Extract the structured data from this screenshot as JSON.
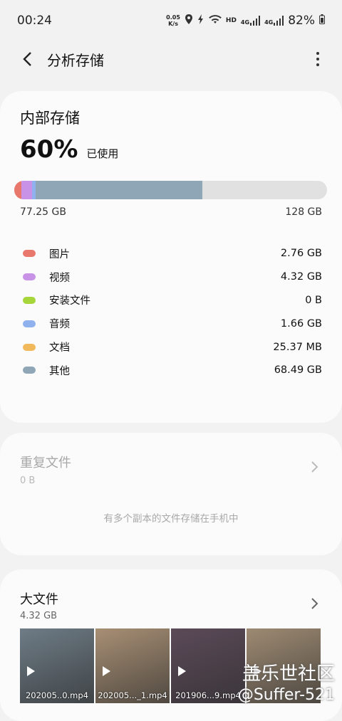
{
  "status_bar": {
    "time": "00:24",
    "net_speed_top": "0.05",
    "net_speed_bottom": "K/s",
    "hd": "HD",
    "lte1": "4G",
    "lte2": "4G",
    "battery": "82%"
  },
  "app_bar": {
    "title": "分析存储",
    "back_icon": "arrow-back-icon",
    "more_icon": "more-vert-icon"
  },
  "internal": {
    "title": "内部存储",
    "percent": "60%",
    "used_label": "已使用",
    "used": "77.25 GB",
    "total": "128 GB",
    "used_fraction": 0.6,
    "categories": [
      {
        "name": "图片",
        "value": "2.76 GB",
        "color": "#e8776c",
        "gb": 2.76
      },
      {
        "name": "视频",
        "value": "4.32 GB",
        "color": "#c893e6",
        "gb": 4.32
      },
      {
        "name": "安装文件",
        "value": "0 B",
        "color": "#a6d63a",
        "gb": 0
      },
      {
        "name": "音频",
        "value": "1.66 GB",
        "color": "#8fb2ef",
        "gb": 1.66
      },
      {
        "name": "文档",
        "value": "25.37 MB",
        "color": "#f1b95c",
        "gb": 0.025
      },
      {
        "name": "其他",
        "value": "68.49 GB",
        "color": "#8ea6b5",
        "gb": 68.49
      }
    ]
  },
  "duplicates": {
    "title": "重复文件",
    "size": "0 B",
    "description": "有多个副本的文件存储在手机中"
  },
  "large_files": {
    "title": "大文件",
    "size": "4.32 GB",
    "files": [
      {
        "name": "202005..0.mp4",
        "color": "#6e7c86"
      },
      {
        "name": "202005..._1.mp4",
        "color": "#a88f74"
      },
      {
        "name": "201906...9.mp4",
        "color": "#5b4a58"
      },
      {
        "name": "",
        "color": "#9e8a72"
      }
    ]
  },
  "watermark": {
    "line1": "盖乐世社区",
    "line2": "@Suffer-521"
  }
}
